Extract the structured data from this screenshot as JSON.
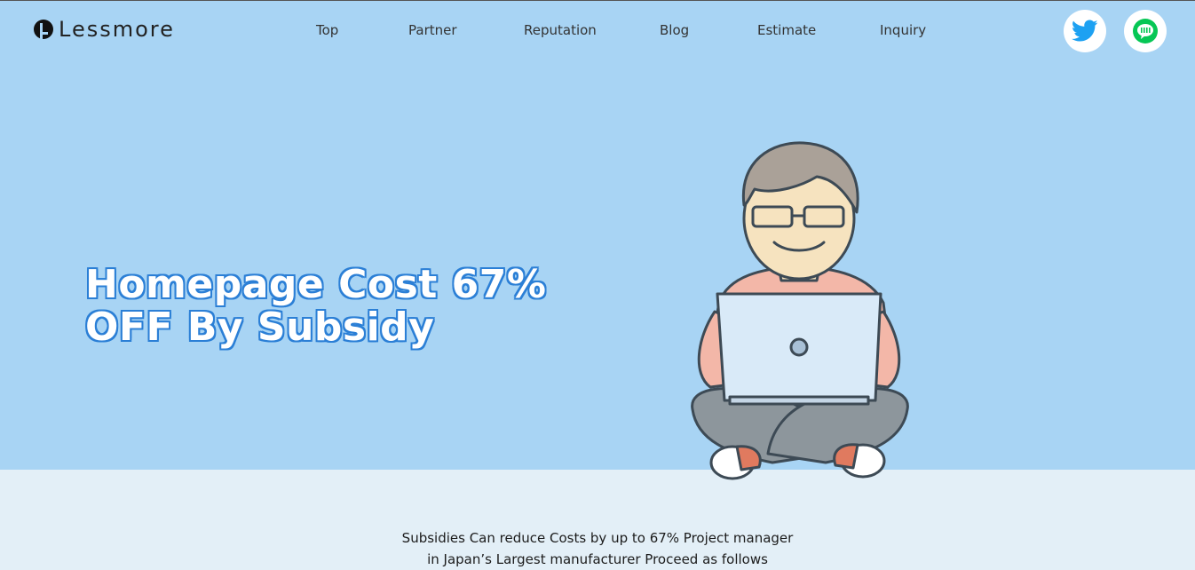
{
  "brand": {
    "name": "Lessmore"
  },
  "nav": {
    "items": [
      {
        "label": "Top"
      },
      {
        "label": "Partner"
      },
      {
        "label": "Reputation"
      },
      {
        "label": "Blog"
      },
      {
        "label": "Estimate"
      },
      {
        "label": "Inquiry"
      }
    ]
  },
  "social": {
    "twitter_icon": "twitter-bird-icon",
    "line_icon": "line-chat-icon",
    "twitter_color": "#1da1f2",
    "line_color": "#06c755"
  },
  "hero": {
    "headline_line1": "Homepage Cost 67%",
    "headline_line2": "OFF By Subsidy",
    "background_color": "#a8d4f4",
    "illustration": "person-with-laptop-illustration"
  },
  "intro": {
    "line1": "Subsidies Can reduce Costs by up to 67% Project manager",
    "line2": "in Japan’s Largest manufacturer Proceed as follows"
  }
}
